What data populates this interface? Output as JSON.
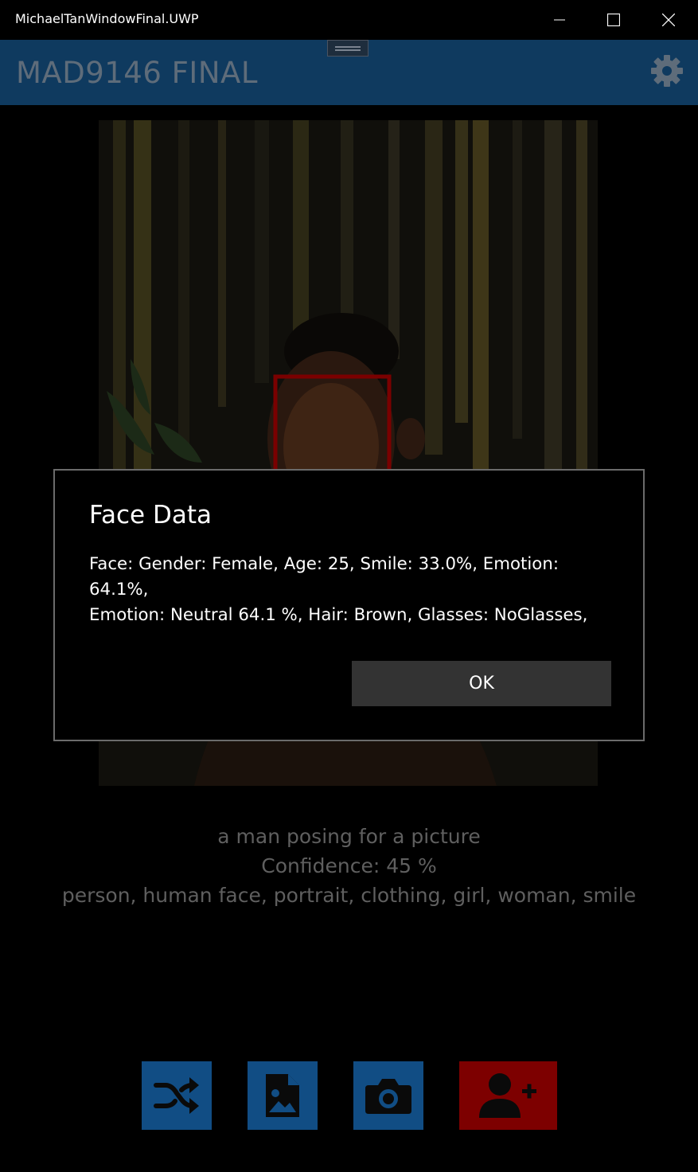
{
  "window": {
    "title": "MichaelTanWindowFinal.UWP"
  },
  "appbar": {
    "title": "MAD9146 FINAL",
    "accent": "#0f3a5f",
    "settings_icon": "gear-icon"
  },
  "analysis": {
    "description": "a man posing for a picture",
    "confidence": "Confidence: 45 %",
    "tags": "person, human face, portrait, clothing, girl, woman, smile"
  },
  "actions": [
    {
      "icon": "shuffle-icon",
      "color": "#114d84"
    },
    {
      "icon": "image-file-icon",
      "color": "#114d84"
    },
    {
      "icon": "camera-icon",
      "color": "#114d84"
    },
    {
      "icon": "add-person-icon",
      "color": "#7d0000"
    }
  ],
  "dialog": {
    "title": "Face Data",
    "line1": "Face: Gender: Female, Age: 25, Smile: 33.0%, Emotion: 64.1%,",
    "line2": "Emotion: Neutral 64.1 %, Hair: Brown, Glasses: NoGlasses,",
    "ok_label": "OK"
  }
}
